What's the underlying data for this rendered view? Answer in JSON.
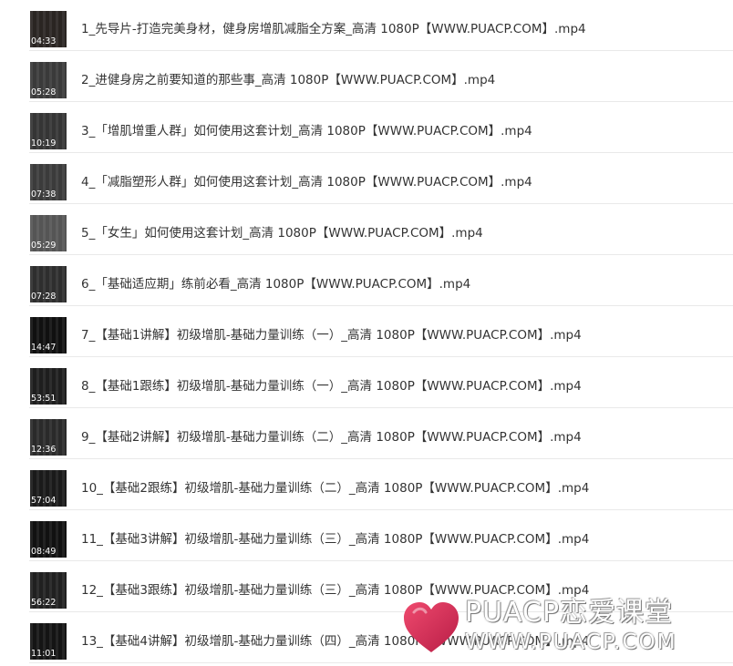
{
  "files": [
    {
      "name": "1_先导片-打造完美身材，健身房增肌减脂全方案_高清 1080P【WWW.PUACP.COM】.mp4",
      "duration": "04:33",
      "thumb_color": "#2a2522",
      "icon": "video-thumbnail"
    },
    {
      "name": "2_进健身房之前要知道的那些事_高清 1080P【WWW.PUACP.COM】.mp4",
      "duration": "05:28",
      "thumb_color": "#3a3a3a",
      "icon": "video-thumbnail"
    },
    {
      "name": "3_「增肌增重人群」如何使用这套计划_高清 1080P【WWW.PUACP.COM】.mp4",
      "duration": "10:19",
      "thumb_color": "#353535",
      "icon": "video-thumbnail"
    },
    {
      "name": "4_「减脂塑形人群」如何使用这套计划_高清 1080P【WWW.PUACP.COM】.mp4",
      "duration": "07:38",
      "thumb_color": "#3b3b3b",
      "icon": "video-thumbnail"
    },
    {
      "name": "5_「女生」如何使用这套计划_高清 1080P【WWW.PUACP.COM】.mp4",
      "duration": "05:29",
      "thumb_color": "#555555",
      "icon": "video-thumbnail"
    },
    {
      "name": "6_「基础适应期」练前必看_高清 1080P【WWW.PUACP.COM】.mp4",
      "duration": "07:28",
      "thumb_color": "#2e2e2e",
      "icon": "video-thumbnail"
    },
    {
      "name": "7_【基础1讲解】初级增肌-基础力量训练（一）_高清 1080P【WWW.PUACP.COM】.mp4",
      "duration": "14:47",
      "thumb_color": "#101010",
      "icon": "video-thumbnail"
    },
    {
      "name": "8_【基础1跟练】初级增肌-基础力量训练（一）_高清 1080P【WWW.PUACP.COM】.mp4",
      "duration": "53:51",
      "thumb_color": "#1e1e1e",
      "icon": "video-thumbnail"
    },
    {
      "name": "9_【基础2讲解】初级增肌-基础力量训练（二）_高清 1080P【WWW.PUACP.COM】.mp4",
      "duration": "12:36",
      "thumb_color": "#2a2a2a",
      "icon": "video-thumbnail"
    },
    {
      "name": "10_【基础2跟练】初级增肌-基础力量训练（二）_高清 1080P【WWW.PUACP.COM】.mp4",
      "duration": "57:04",
      "thumb_color": "#1a1a1a",
      "icon": "video-thumbnail"
    },
    {
      "name": "11_【基础3讲解】初级增肌-基础力量训练（三）_高清 1080P【WWW.PUACP.COM】.mp4",
      "duration": "08:49",
      "thumb_color": "#111111",
      "icon": "video-thumbnail"
    },
    {
      "name": "12_【基础3跟练】初级增肌-基础力量训练（三）_高清 1080P【WWW.PUACP.COM】.mp4",
      "duration": "56:22",
      "thumb_color": "#202020",
      "icon": "video-thumbnail"
    },
    {
      "name": "13_【基础4讲解】初级增肌-基础力量训练（四）_高清 1080P【WWW.PUACP.COM】.mp4",
      "duration": "11:01",
      "thumb_color": "#141414",
      "icon": "video-thumbnail"
    }
  ],
  "watermark": {
    "line1": "PUACP恋爱课堂",
    "line2": "WWW.PUACP.COM",
    "heart_color": "#d8325a",
    "icon": "heart-logo-icon"
  }
}
